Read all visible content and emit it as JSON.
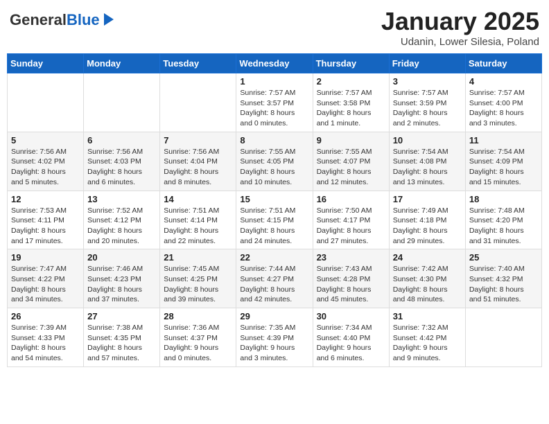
{
  "header": {
    "logo_general": "General",
    "logo_blue": "Blue",
    "month_title": "January 2025",
    "subtitle": "Udanin, Lower Silesia, Poland"
  },
  "calendar": {
    "days_of_week": [
      "Sunday",
      "Monday",
      "Tuesday",
      "Wednesday",
      "Thursday",
      "Friday",
      "Saturday"
    ],
    "weeks": [
      [
        {
          "day": "",
          "text": ""
        },
        {
          "day": "",
          "text": ""
        },
        {
          "day": "",
          "text": ""
        },
        {
          "day": "1",
          "text": "Sunrise: 7:57 AM\nSunset: 3:57 PM\nDaylight: 8 hours\nand 0 minutes."
        },
        {
          "day": "2",
          "text": "Sunrise: 7:57 AM\nSunset: 3:58 PM\nDaylight: 8 hours\nand 1 minute."
        },
        {
          "day": "3",
          "text": "Sunrise: 7:57 AM\nSunset: 3:59 PM\nDaylight: 8 hours\nand 2 minutes."
        },
        {
          "day": "4",
          "text": "Sunrise: 7:57 AM\nSunset: 4:00 PM\nDaylight: 8 hours\nand 3 minutes."
        }
      ],
      [
        {
          "day": "5",
          "text": "Sunrise: 7:56 AM\nSunset: 4:02 PM\nDaylight: 8 hours\nand 5 minutes."
        },
        {
          "day": "6",
          "text": "Sunrise: 7:56 AM\nSunset: 4:03 PM\nDaylight: 8 hours\nand 6 minutes."
        },
        {
          "day": "7",
          "text": "Sunrise: 7:56 AM\nSunset: 4:04 PM\nDaylight: 8 hours\nand 8 minutes."
        },
        {
          "day": "8",
          "text": "Sunrise: 7:55 AM\nSunset: 4:05 PM\nDaylight: 8 hours\nand 10 minutes."
        },
        {
          "day": "9",
          "text": "Sunrise: 7:55 AM\nSunset: 4:07 PM\nDaylight: 8 hours\nand 12 minutes."
        },
        {
          "day": "10",
          "text": "Sunrise: 7:54 AM\nSunset: 4:08 PM\nDaylight: 8 hours\nand 13 minutes."
        },
        {
          "day": "11",
          "text": "Sunrise: 7:54 AM\nSunset: 4:09 PM\nDaylight: 8 hours\nand 15 minutes."
        }
      ],
      [
        {
          "day": "12",
          "text": "Sunrise: 7:53 AM\nSunset: 4:11 PM\nDaylight: 8 hours\nand 17 minutes."
        },
        {
          "day": "13",
          "text": "Sunrise: 7:52 AM\nSunset: 4:12 PM\nDaylight: 8 hours\nand 20 minutes."
        },
        {
          "day": "14",
          "text": "Sunrise: 7:51 AM\nSunset: 4:14 PM\nDaylight: 8 hours\nand 22 minutes."
        },
        {
          "day": "15",
          "text": "Sunrise: 7:51 AM\nSunset: 4:15 PM\nDaylight: 8 hours\nand 24 minutes."
        },
        {
          "day": "16",
          "text": "Sunrise: 7:50 AM\nSunset: 4:17 PM\nDaylight: 8 hours\nand 27 minutes."
        },
        {
          "day": "17",
          "text": "Sunrise: 7:49 AM\nSunset: 4:18 PM\nDaylight: 8 hours\nand 29 minutes."
        },
        {
          "day": "18",
          "text": "Sunrise: 7:48 AM\nSunset: 4:20 PM\nDaylight: 8 hours\nand 31 minutes."
        }
      ],
      [
        {
          "day": "19",
          "text": "Sunrise: 7:47 AM\nSunset: 4:22 PM\nDaylight: 8 hours\nand 34 minutes."
        },
        {
          "day": "20",
          "text": "Sunrise: 7:46 AM\nSunset: 4:23 PM\nDaylight: 8 hours\nand 37 minutes."
        },
        {
          "day": "21",
          "text": "Sunrise: 7:45 AM\nSunset: 4:25 PM\nDaylight: 8 hours\nand 39 minutes."
        },
        {
          "day": "22",
          "text": "Sunrise: 7:44 AM\nSunset: 4:27 PM\nDaylight: 8 hours\nand 42 minutes."
        },
        {
          "day": "23",
          "text": "Sunrise: 7:43 AM\nSunset: 4:28 PM\nDaylight: 8 hours\nand 45 minutes."
        },
        {
          "day": "24",
          "text": "Sunrise: 7:42 AM\nSunset: 4:30 PM\nDaylight: 8 hours\nand 48 minutes."
        },
        {
          "day": "25",
          "text": "Sunrise: 7:40 AM\nSunset: 4:32 PM\nDaylight: 8 hours\nand 51 minutes."
        }
      ],
      [
        {
          "day": "26",
          "text": "Sunrise: 7:39 AM\nSunset: 4:33 PM\nDaylight: 8 hours\nand 54 minutes."
        },
        {
          "day": "27",
          "text": "Sunrise: 7:38 AM\nSunset: 4:35 PM\nDaylight: 8 hours\nand 57 minutes."
        },
        {
          "day": "28",
          "text": "Sunrise: 7:36 AM\nSunset: 4:37 PM\nDaylight: 9 hours\nand 0 minutes."
        },
        {
          "day": "29",
          "text": "Sunrise: 7:35 AM\nSunset: 4:39 PM\nDaylight: 9 hours\nand 3 minutes."
        },
        {
          "day": "30",
          "text": "Sunrise: 7:34 AM\nSunset: 4:40 PM\nDaylight: 9 hours\nand 6 minutes."
        },
        {
          "day": "31",
          "text": "Sunrise: 7:32 AM\nSunset: 4:42 PM\nDaylight: 9 hours\nand 9 minutes."
        },
        {
          "day": "",
          "text": ""
        }
      ]
    ]
  }
}
